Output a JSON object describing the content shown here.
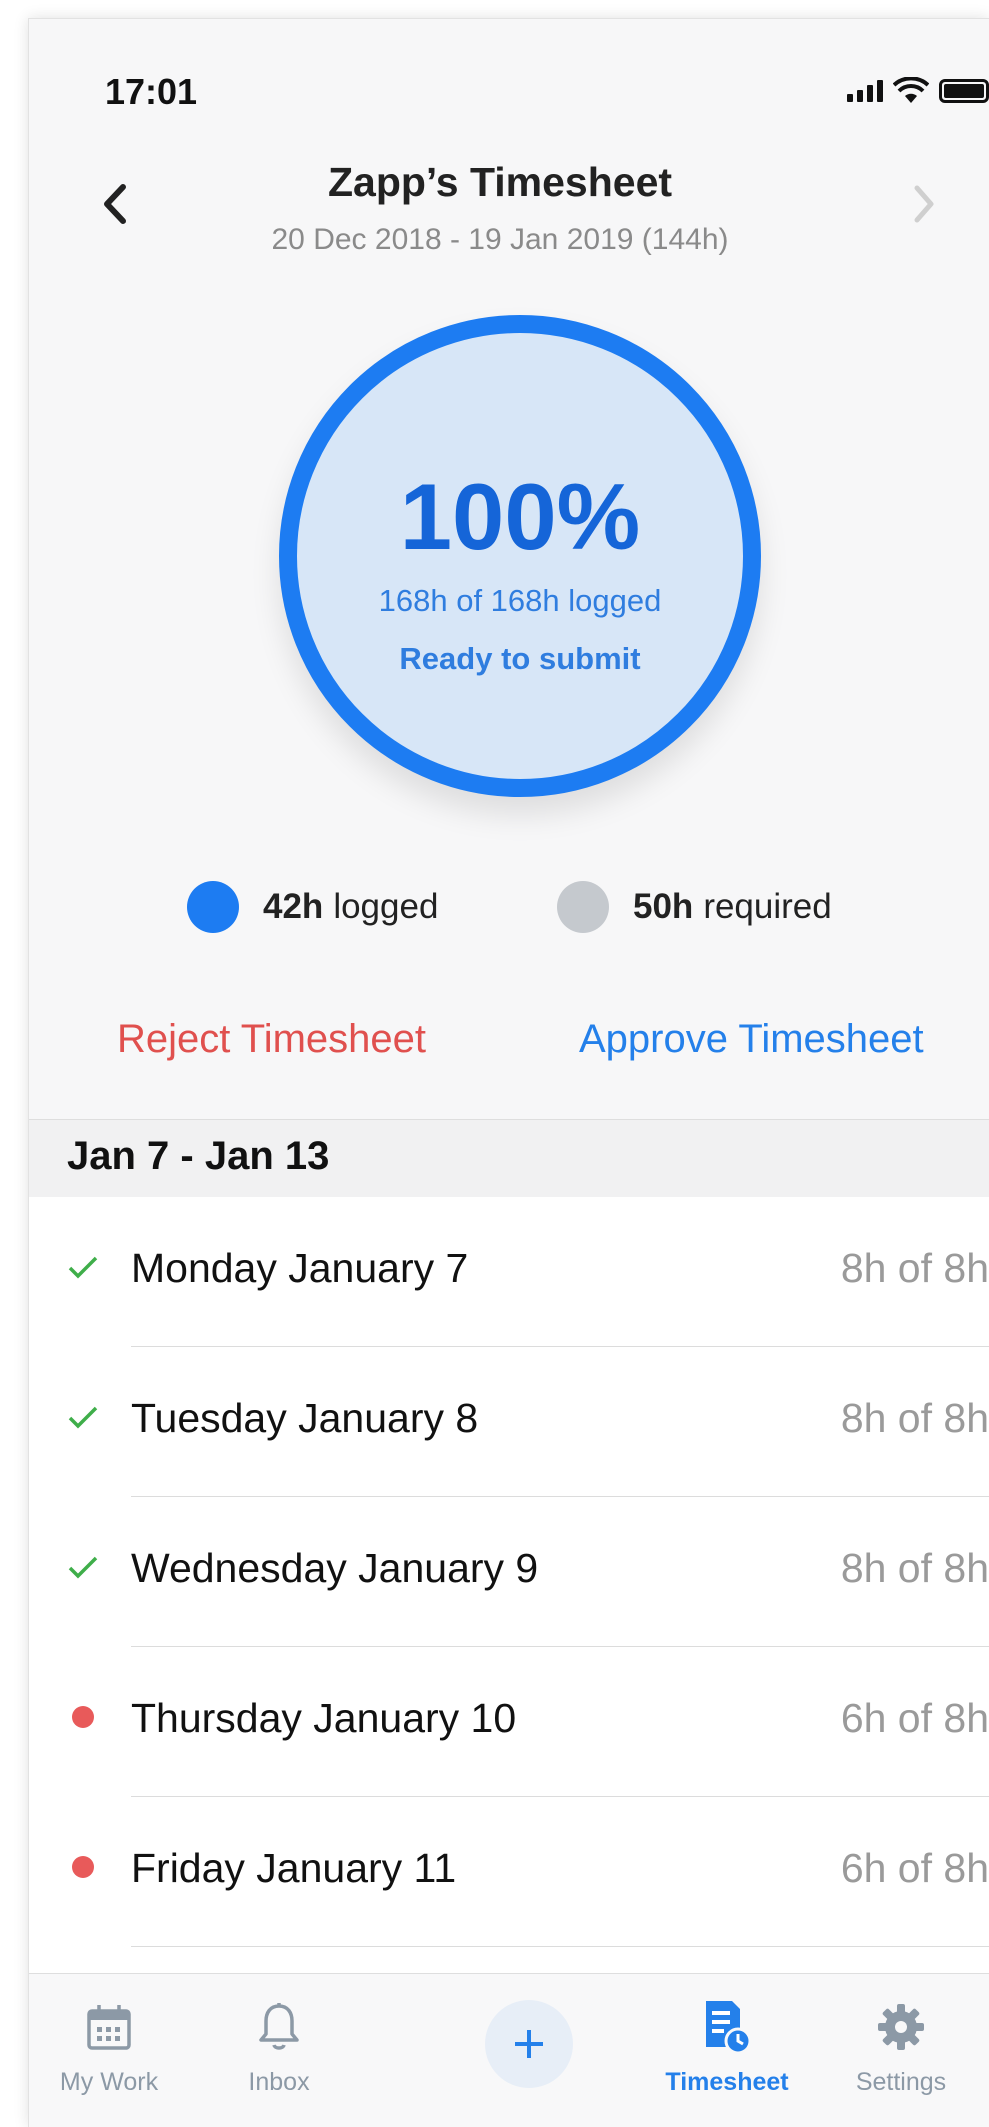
{
  "status_bar": {
    "time": "17:01"
  },
  "header": {
    "title": "Zapp’s Timesheet",
    "subtitle": "20 Dec 2018 - 19 Jan 2019 (144h)"
  },
  "progress": {
    "percent_label": "100%",
    "logged_text": "168h of 168h logged",
    "status_text": "Ready to submit",
    "fraction": 1.0
  },
  "legend": {
    "logged": {
      "value": "42h",
      "label": "logged",
      "color": "#1d7cf2"
    },
    "required": {
      "value": "50h",
      "label": "required",
      "color": "#c5c9ce"
    }
  },
  "actions": {
    "reject_label": "Reject Timesheet",
    "approve_label": "Approve Timesheet"
  },
  "week": {
    "label": "Jan 7 - Jan 13",
    "days": [
      {
        "name": "Monday January 7",
        "hours": "8h of 8h",
        "status": "complete"
      },
      {
        "name": "Tuesday January 8",
        "hours": "8h of 8h",
        "status": "complete"
      },
      {
        "name": "Wednesday January 9",
        "hours": "8h of 8h",
        "status": "complete"
      },
      {
        "name": "Thursday January 10",
        "hours": "6h of 8h",
        "status": "incomplete"
      },
      {
        "name": "Friday January 11",
        "hours": "6h of 8h",
        "status": "incomplete"
      }
    ]
  },
  "tab_bar": {
    "tabs": [
      {
        "label": "My Work",
        "icon": "calendar-icon"
      },
      {
        "label": "Inbox",
        "icon": "bell-icon"
      },
      {
        "label": "Timesheet",
        "icon": "timesheet-icon",
        "active": true
      },
      {
        "label": "Settings",
        "icon": "gear-icon"
      }
    ],
    "add_icon": "plus-icon"
  },
  "colors": {
    "accent": "#2480ea",
    "reject": "#e0504e",
    "complete": "#3fae4a",
    "incomplete": "#e85a5a"
  }
}
